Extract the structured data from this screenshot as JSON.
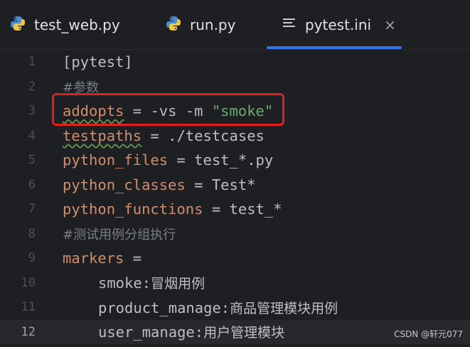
{
  "tabs": [
    {
      "label": "test_web.py",
      "icon": "python-icon"
    },
    {
      "label": "run.py",
      "icon": "python-icon"
    },
    {
      "label": "pytest.ini",
      "icon": "ini-file-icon",
      "active": true,
      "close": "×"
    }
  ],
  "editor": {
    "lines": [
      {
        "num": "1",
        "text": "[pytest]"
      },
      {
        "num": "2",
        "text": "#参数"
      },
      {
        "num": "3",
        "key": "addopts",
        "op": " = ",
        "val": "-vs -m ",
        "str": "\"smoke\""
      },
      {
        "num": "4",
        "key": "testpaths",
        "op": " = ",
        "val": "./testcases"
      },
      {
        "num": "5",
        "key": "python_files",
        "op": " = ",
        "val": "test_*.py"
      },
      {
        "num": "6",
        "key": "python_classes",
        "op": " = ",
        "val": "Test*"
      },
      {
        "num": "7",
        "key": "python_functions",
        "op": " = ",
        "val": "test_*"
      },
      {
        "num": "8",
        "text": "#测试用例分组执行"
      },
      {
        "num": "9",
        "key": "markers",
        "op": " ="
      },
      {
        "num": "10",
        "mkey": "smoke:",
        "mdesc": "冒烟用例"
      },
      {
        "num": "11",
        "mkey": "product_manage:",
        "mdesc": "商品管理模块用例"
      },
      {
        "num": "12",
        "mkey": "user_manage:",
        "mdesc": "用户管理模块"
      }
    ]
  },
  "watermark": "CSDN @轩元077",
  "colors": {
    "accent": "#3574f0",
    "highlight_box": "#e02020",
    "keyword": "#cf8e6d",
    "string": "#6aab73"
  }
}
